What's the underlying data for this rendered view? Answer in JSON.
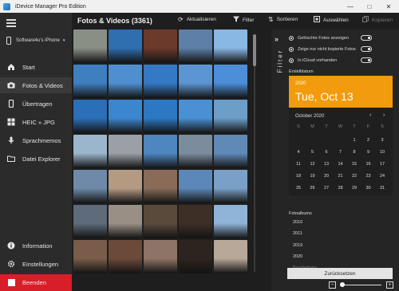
{
  "window": {
    "title": "iDevice Manager Pro Edition",
    "minimize": "—",
    "maximize": "□",
    "close": "✕"
  },
  "sidebar": {
    "device_name": "Software4u's iPhone",
    "items": [
      {
        "label": "Start",
        "icon": "home-icon"
      },
      {
        "label": "Fotos & Videos",
        "icon": "camera-icon",
        "active": true
      },
      {
        "label": "Übertragen",
        "icon": "phone-transfer-icon"
      },
      {
        "label": "HEIC » JPG",
        "icon": "convert-icon"
      },
      {
        "label": "Sprachmemos",
        "icon": "microphone-icon"
      },
      {
        "label": "Datei Explorer",
        "icon": "folder-icon"
      }
    ],
    "bottom": [
      {
        "label": "Information",
        "icon": "info-icon"
      },
      {
        "label": "Einstellungen",
        "icon": "gear-icon"
      },
      {
        "label": "Beenden",
        "icon": "exit-icon"
      }
    ]
  },
  "toolbar": {
    "title": "Fotos & Videos (3361)",
    "refresh": "Aktualisieren",
    "filter": "Filter",
    "sort": "Sortieren",
    "select": "Auswählen",
    "copy": "Kopieren"
  },
  "filters": {
    "panel_label": "Filter",
    "toggles": [
      "Gelöschte Fotos anzeigen",
      "Zeige nur nicht kopierte Fotos",
      "In iCloud vorhanden"
    ],
    "date_label": "Erstelldatum",
    "calendar": {
      "year": "2020",
      "date": "Tue, Oct 13",
      "month": "October 2020",
      "weekdays": [
        "S",
        "M",
        "T",
        "W",
        "T",
        "F",
        "S"
      ],
      "weeks": [
        [
          "",
          "",
          "",
          "",
          "1",
          "2",
          "3"
        ],
        [
          "4",
          "5",
          "6",
          "7",
          "8",
          "9",
          "10"
        ],
        [
          "11",
          "12",
          "13",
          "14",
          "15",
          "16",
          "17"
        ],
        [
          "18",
          "19",
          "20",
          "21",
          "22",
          "23",
          "24"
        ],
        [
          "25",
          "26",
          "27",
          "28",
          "29",
          "30",
          "31"
        ]
      ]
    },
    "album_label": "Fotoalbums",
    "albums": [
      "2010",
      "2011",
      "2019",
      "2020",
      "Bearbeitung"
    ],
    "reset": "Zurücksetzen"
  },
  "colors": {
    "accent": "#f29b0c",
    "quit": "#d81e28"
  }
}
